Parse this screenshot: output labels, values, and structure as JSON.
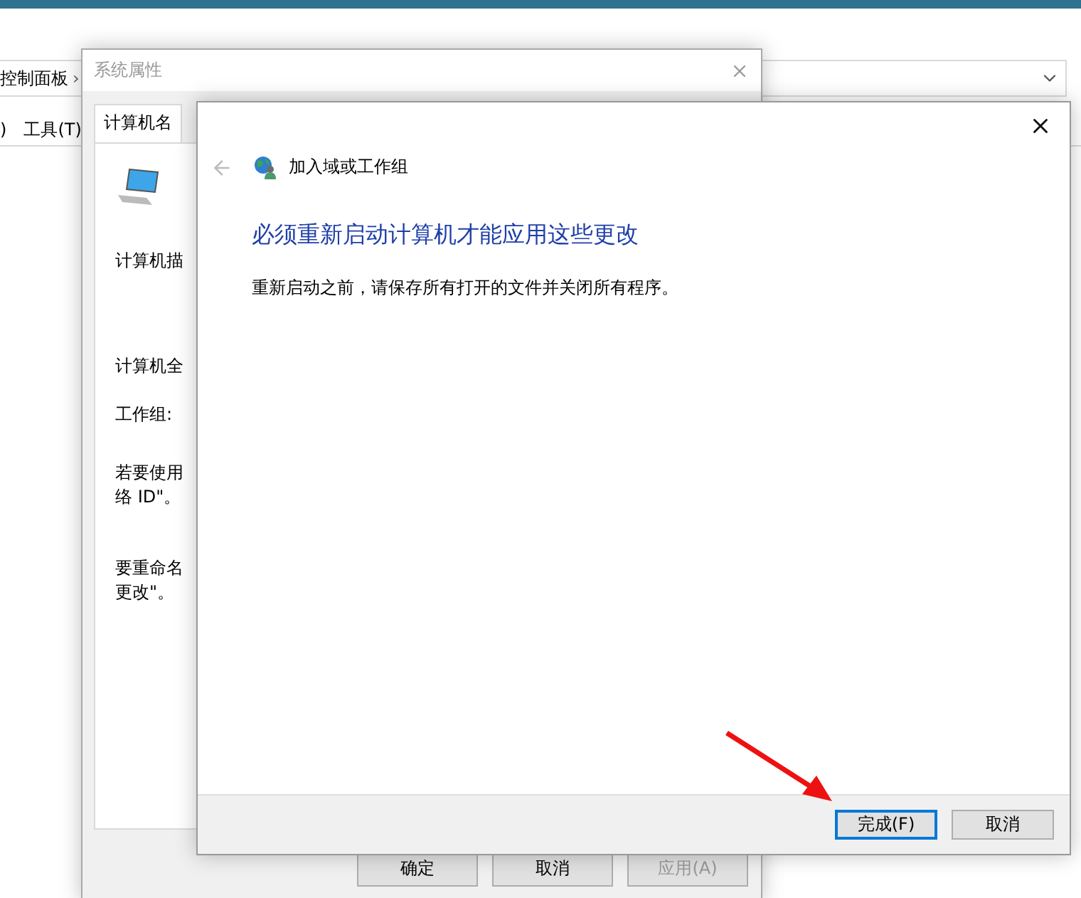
{
  "explorer": {
    "breadcrumb": "控制面板",
    "separator": "›",
    "menu": [
      ")",
      "工具(T)"
    ]
  },
  "system_properties": {
    "title": "系统属性",
    "tabs": [
      {
        "label": "计算机名",
        "selected": true
      }
    ],
    "labels": [
      {
        "lines": [
          "计算机描"
        ]
      },
      {
        "lines": [
          "计算机全"
        ]
      },
      {
        "lines": [
          "工作组:"
        ]
      },
      {
        "lines": [
          "若要使用",
          "络 ID\"。"
        ]
      },
      {
        "lines": [
          "要重命名",
          "更改\"。"
        ]
      }
    ],
    "buttons": [
      {
        "label": "确定",
        "disabled": false
      },
      {
        "label": "取消",
        "disabled": false
      },
      {
        "label": "应用(A)",
        "disabled": true
      }
    ]
  },
  "wizard": {
    "title": "加入域或工作组",
    "back_disabled": true,
    "heading": "必须重新启动计算机才能应用这些更改",
    "message": "重新启动之前，请保存所有打开的文件并关闭所有程序。",
    "buttons": [
      {
        "label": "完成(F)",
        "default": true
      },
      {
        "label": "取消",
        "default": false
      }
    ]
  }
}
